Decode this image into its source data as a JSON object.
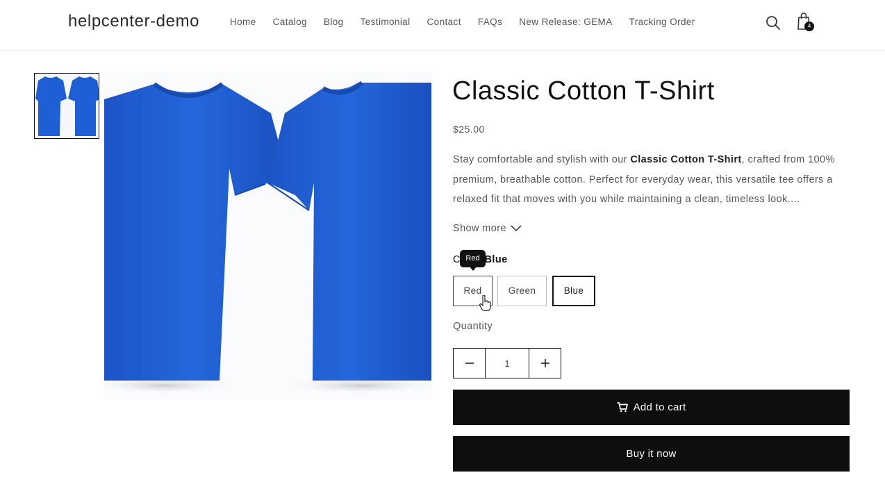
{
  "header": {
    "logo": "helpcenter-demo",
    "nav": [
      "Home",
      "Catalog",
      "Blog",
      "Testimonial",
      "Contact",
      "FAQs",
      "New Release: GEMA",
      "Tracking Order"
    ],
    "cart_count": "4",
    "icons": {
      "search": "search-icon",
      "cart": "shopping-bag-icon"
    }
  },
  "product": {
    "title": "Classic Cotton T-Shirt",
    "price": "$25.00",
    "description_prefix": "Stay comfortable and stylish with our ",
    "description_bold": "Classic Cotton T-Shirt",
    "description_suffix": ", crafted from 100% premium, breathable cotton. Perfect for everyday wear, this versatile tee offers a relaxed fit that moves with you while maintaining a clean, timeless look....",
    "show_more": "Show more",
    "color_label": "Color:",
    "color_selected": "Blue",
    "tooltip": "Red",
    "colors": [
      "Red",
      "Green",
      "Blue"
    ],
    "quantity_label": "Quantity",
    "quantity_value": "1",
    "add_to_cart": "Add to cart",
    "buy_now": "Buy it now",
    "shirt_color": "#1f5fd6"
  }
}
